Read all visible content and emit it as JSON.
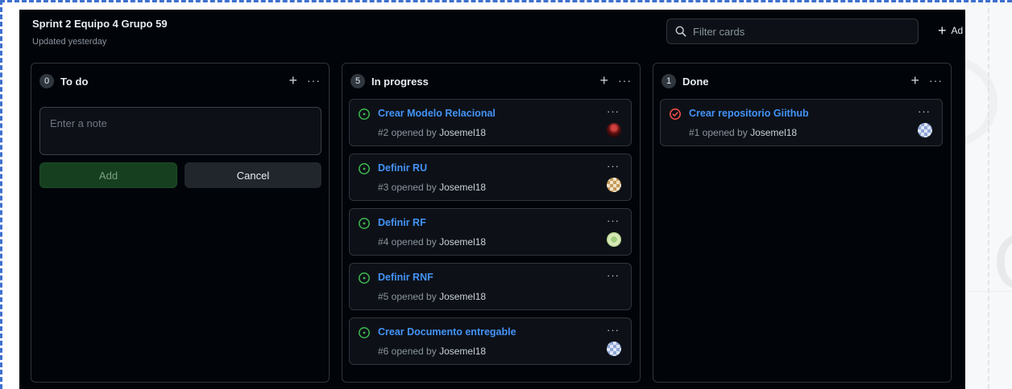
{
  "project": {
    "title": "Sprint 2 Equipo 4 Grupo 59",
    "updated": "Updated yesterday"
  },
  "filter": {
    "placeholder": "Filter cards"
  },
  "add_column_label": "Ad",
  "columns": [
    {
      "name": "To do",
      "count": "0",
      "note_placeholder": "Enter a note",
      "add_label": "Add",
      "cancel_label": "Cancel"
    },
    {
      "name": "In progress",
      "count": "5",
      "cards": [
        {
          "title": "Crear Modelo Relacional",
          "meta_prefix": "#2 opened by ",
          "author": "Josemel18",
          "icon": "issue-open-icon"
        },
        {
          "title": "Definir RU",
          "meta_prefix": "#3 opened by ",
          "author": "Josemel18",
          "icon": "issue-open-icon"
        },
        {
          "title": "Definir RF",
          "meta_prefix": "#4 opened by ",
          "author": "Josemel18",
          "icon": "issue-open-icon"
        },
        {
          "title": "Definir RNF",
          "meta_prefix": "#5 opened by ",
          "author": "Josemel18",
          "icon": "issue-open-icon"
        },
        {
          "title": "Crear Documento entregable",
          "meta_prefix": "#6 opened by ",
          "author": "Josemel18",
          "icon": "issue-open-icon"
        }
      ]
    },
    {
      "name": "Done",
      "count": "1",
      "cards": [
        {
          "title": "Crear repositorio Giithub",
          "meta_prefix": "#1 opened by ",
          "author": "Josemel18",
          "icon": "issue-closed-icon"
        }
      ]
    }
  ],
  "colors": {
    "open_icon": "#3fb950",
    "closed_icon": "#f85149",
    "link": "#4493f8",
    "selection_border": "#3d6fce"
  }
}
